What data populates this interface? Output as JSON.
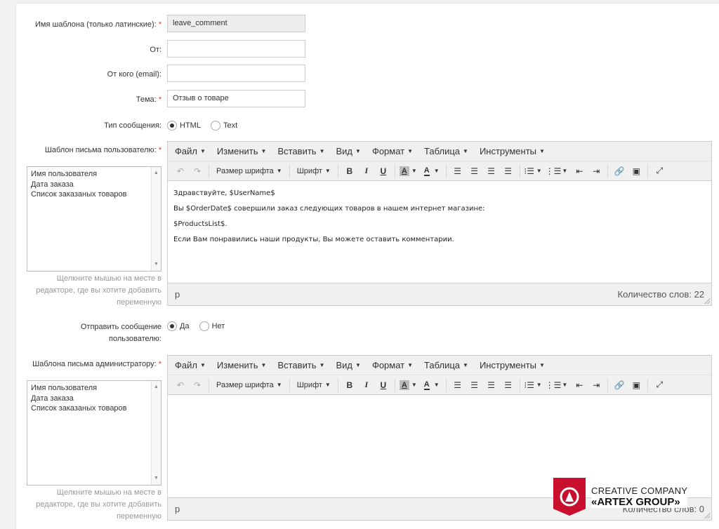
{
  "fields": {
    "template_name": {
      "label": "Имя шаблона (только латинские):",
      "value": "leave_comment"
    },
    "from": {
      "label": "От:",
      "value": ""
    },
    "from_email": {
      "label": "От кого (email):",
      "value": ""
    },
    "subject": {
      "label": "Тема:",
      "value": "Отзыв о товаре"
    },
    "message_type": {
      "label": "Тип сообщения:",
      "options": [
        "HTML",
        "Text"
      ],
      "selected": "HTML"
    },
    "send_to_user": {
      "label_line1": "Отправить сообщение",
      "label_line2": "пользователю:",
      "options": [
        "Да",
        "Нет"
      ],
      "selected": "Да"
    }
  },
  "editor_menu": [
    "Файл",
    "Изменить",
    "Вставить",
    "Вид",
    "Формат",
    "Таблица",
    "Инструменты"
  ],
  "toolbar": {
    "font_size": "Размер шрифта",
    "font": "Шрифт",
    "bold": "B",
    "italic": "I",
    "underline": "U",
    "highlight": "A",
    "font_color": "A"
  },
  "variables": [
    "Имя пользователя",
    "Дата заказа",
    "Список заказаных товаров"
  ],
  "hint": [
    "Щелкните мышью на месте в",
    "редакторе, где вы хотите добавить",
    "переменную"
  ],
  "user_template": {
    "label": "Шаблон письма пользователю:",
    "content": [
      "Здравствуйте, $UserName$",
      "Вы $OrderDate$ совершили заказ следующих товаров в нашем интернет магазине:",
      "$ProductsList$.",
      "Если Вам понравились наши продукты, Вы можете оставить комментарии."
    ],
    "path": "p",
    "word_count": "Количество слов: 22"
  },
  "admin_template": {
    "label": "Шаблона письма администратору:",
    "content": [],
    "path": "p",
    "word_count": "Количество слов: 0"
  },
  "watermark": {
    "line1": "CREATIVE COMPANY",
    "line2": "«ARTEX GROUP»"
  },
  "colors": {
    "required": "#e03c31",
    "brand_red": "#c8102e"
  }
}
